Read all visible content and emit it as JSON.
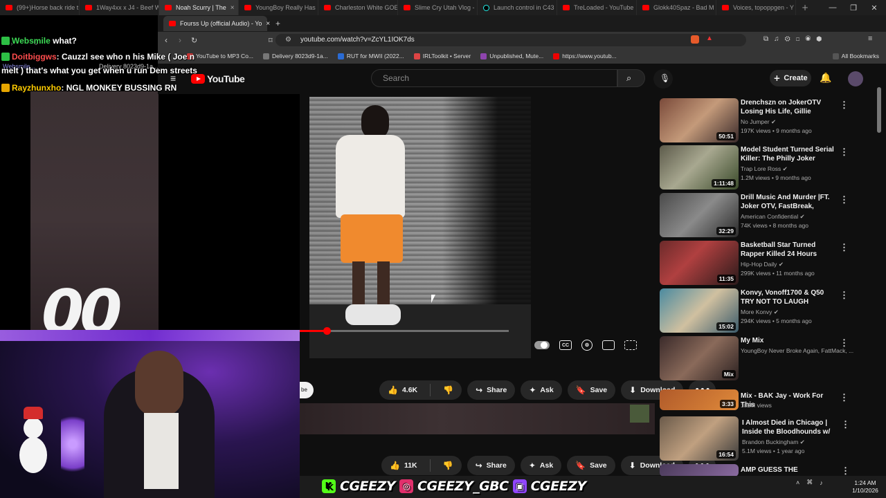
{
  "browser_tabs": [
    {
      "label": "(99+)Horse back ride t"
    },
    {
      "label": "1Way4xx x J4 - Beef W"
    },
    {
      "label": "Noah Scurry | The",
      "active": true
    },
    {
      "label": "YoungBoy Really Has"
    },
    {
      "label": "Charleston White GOE"
    },
    {
      "label": "Slime Cry Utah Vlog -"
    },
    {
      "label": "Launch control in C43"
    },
    {
      "label": "TreLoaded - YouTube"
    },
    {
      "label": "Glokk40Spaz - Bad M"
    },
    {
      "label": "Voices, topoppgen - Y"
    }
  ],
  "inner_browser": {
    "active_tab": "Fourss Up (official Audio) - Yo",
    "url": "youtube.com/watch?v=ZcYL1IOK7ds",
    "bookmarks": [
      {
        "label": "YouTube to MP3 Co..."
      },
      {
        "label": "Delivery 8023d9-1a..."
      },
      {
        "label": "RUT for MWII (2022..."
      },
      {
        "label": "IRLToolkit • Server"
      },
      {
        "label": "Unpublished, Mute..."
      },
      {
        "label": "https://www.youtub..."
      }
    ],
    "all_bookmarks": "All Bookmarks"
  },
  "ghost_bookmarks": [
    "Websmile...",
    "Delivery 8023d9-1a..."
  ],
  "youtube": {
    "logo": "YouTube",
    "search_placeholder": "Search",
    "create_label": "Create",
    "video_progress": 0.13,
    "action_row_1": {
      "likes": "4.6K",
      "share": "Share",
      "ask": "Ask",
      "save": "Save",
      "download": "Download",
      "subscribe_partial": "be"
    },
    "action_row_2": {
      "likes": "11K",
      "share": "Share",
      "ask": "Ask",
      "save": "Save",
      "download": "Download"
    }
  },
  "recommendations": [
    {
      "title": "Drenchszn on JokerOTV Losing His Life, Gillie Claiming Joker ...",
      "channel": "No Jumper",
      "meta": "197K views • 9 months ago",
      "duration": "50:51"
    },
    {
      "title": "Model Student Turned Serial Killer: The Philly Joker",
      "channel": "Trap Lore Ross",
      "meta": "1.2M views • 9 months ago",
      "duration": "1:11:48"
    },
    {
      "title": "Drill Music And Murder |FT. Joker OTV, FastBreak, 9Side, ...",
      "channel": "American Confidential",
      "meta": "74K views • 8 months ago",
      "duration": "32:29"
    },
    {
      "title": "Basketball Star Turned Rapper Killed 24 Hours After Dissing ...",
      "channel": "Hip-Hop Daily",
      "meta": "299K views • 11 months ago",
      "duration": "11:35"
    },
    {
      "title": "Konvy, Vonoff1700 & Q50 TRY NOT TO LAUGH Challenge!",
      "channel": "More Konvy",
      "meta": "294K views • 5 months ago",
      "duration": "15:02"
    },
    {
      "title": "My Mix",
      "channel": "YoungBoy Never Broke Again, FattMack, ...",
      "meta": "",
      "duration": "Mix"
    },
    {
      "title": "Mix - BAK Jay - Work For This",
      "channel": "182M views",
      "meta": "",
      "duration": "3:33"
    },
    {
      "title": "I Almost Died in Chicago | Inside the Bloodhounds w/ Q50, Vert,...",
      "channel": "Brandon Buckingham",
      "meta": "5.1M views • 1 year ago",
      "duration": "16:54"
    },
    {
      "title": "AMP GUESS THE STRIPPER",
      "channel": "",
      "meta": "",
      "duration": ""
    }
  ],
  "chat": [
    {
      "user": "Websmile",
      "message": "what?",
      "color": "#3ddc56"
    },
    {
      "user": "Doitbiggws",
      "message": "Cauzzl see who n his Mike ( Joe n",
      "color": "#ffcc00"
    },
    {
      "user": "",
      "message": "melt ) that's what you get when u run Dem streets",
      "color": "#fff"
    },
    {
      "user": "Rayzhunxho",
      "message": "NGL MONKEY BUSSING RN",
      "color": "#ffcc00"
    }
  ],
  "background_text": "00",
  "stream_overlay": {
    "handle_kick": "CGEEZY",
    "handle_ig": "CGEEZY_GBC",
    "handle_twitch": "CGEEZY"
  },
  "clock": {
    "time": "1:24 AM",
    "date": "1/10/2026"
  },
  "colors": {
    "accent": "#ff0000",
    "bg": "#0f0f0f",
    "kick": "#53fc18",
    "instagram": "#e1306c",
    "twitch": "#9146ff"
  }
}
